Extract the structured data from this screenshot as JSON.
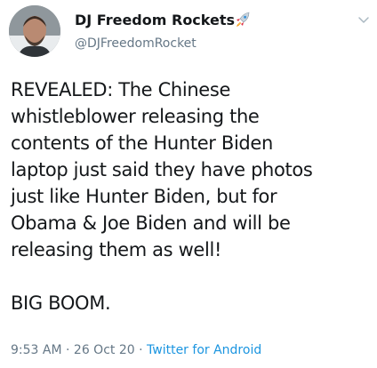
{
  "tweet": {
    "display_name": "DJ Freedom Rockets",
    "handle": "@DJFreedomRocket",
    "name_emoji_icon": "rocket-icon",
    "menu_icon": "chevron-down-icon",
    "text": "REVEALED: The Chinese\nwhistleblower releasing the\ncontents of the Hunter Biden\nlaptop just said they have photos\njust like Hunter Biden, but for\nObama & Joe Biden and will be\nreleasing them as well!\n\nBIG BOOM.",
    "time": "9:53 AM",
    "separator_1": " · ",
    "date": "26 Oct 20",
    "separator_2": " · ",
    "source": "Twitter for Android"
  },
  "colors": {
    "text": "#14171a",
    "secondary": "#657786",
    "link": "#1b95e0",
    "background": "#ffffff"
  }
}
